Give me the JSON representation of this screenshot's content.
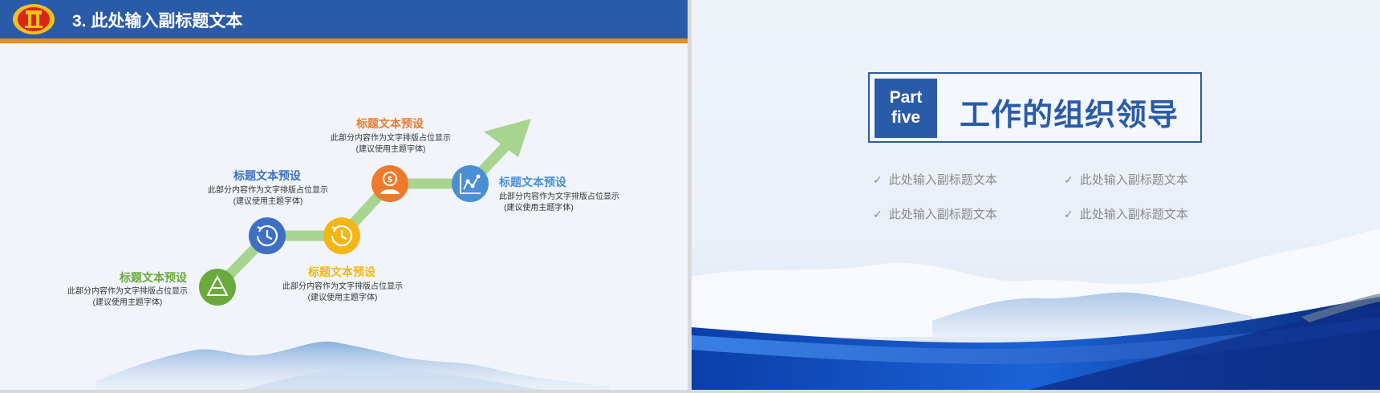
{
  "left_slide": {
    "header_title": "3. 此处输入副标题文本",
    "steps": [
      {
        "title": "标题文本预设",
        "desc_line1": "此部分内容作为文字排版占位显示",
        "desc_line2": "(建议使用主题字体)",
        "color": "#6aaa3c",
        "icon": "triangle-icon"
      },
      {
        "title": "标题文本预设",
        "desc_line1": "此部分内容作为文字排版占位显示",
        "desc_line2": "(建议使用主题字体)",
        "color": "#3e6fc2",
        "icon": "clock-history-icon"
      },
      {
        "title": "标题文本预设",
        "desc_line1": "此部分内容作为文字排版占位显示",
        "desc_line2": "(建议使用主题字体)",
        "color": "#f3b614",
        "icon": "clock-history-icon"
      },
      {
        "title": "标题文本预设",
        "desc_line1": "此部分内容作为文字排版占位显示",
        "desc_line2": "(建议使用主题字体)",
        "color": "#ee7a2a",
        "icon": "money-person-icon"
      },
      {
        "title": "标题文本预设",
        "desc_line1": "此部分内容作为文字排版占位显示",
        "desc_line2": "(建议使用主题字体)",
        "color": "#4a8fd6",
        "icon": "chart-icon"
      }
    ],
    "colors": {
      "header": "#2a5ba8",
      "accent_line": "#ef8a1c",
      "path": "#a9d48f"
    }
  },
  "right_slide": {
    "part_label_line1": "Part",
    "part_label_line2": "five",
    "section_title": "工作的组织领导",
    "bullets": [
      "此处输入副标题文本",
      "此处输入副标题文本",
      "此处输入副标题文本",
      "此处输入副标题文本"
    ]
  }
}
